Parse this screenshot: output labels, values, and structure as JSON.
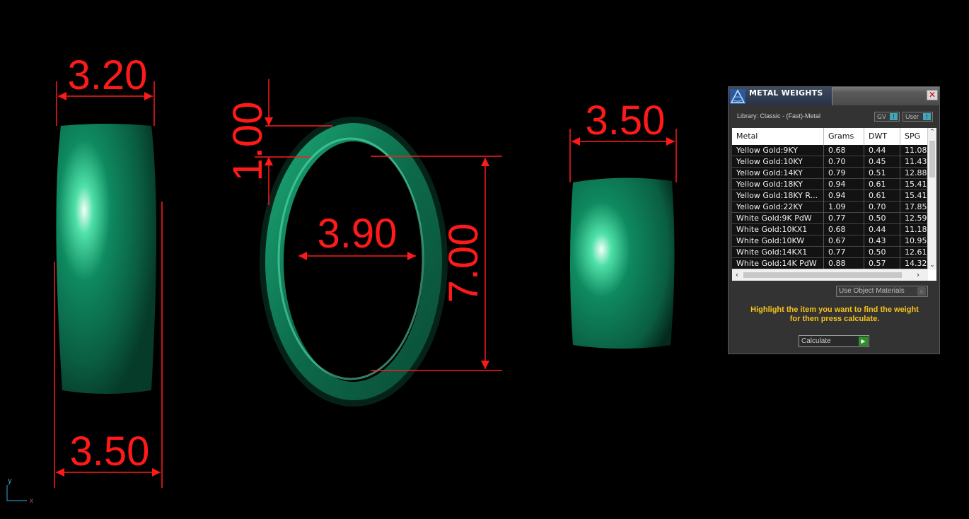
{
  "dimensions": {
    "left_top_width": "3.20",
    "left_bottom_width": "3.50",
    "middle_top_gap": "1.00",
    "middle_inner_width": "3.90",
    "middle_height": "7.00",
    "right_width": "3.50"
  },
  "axis": {
    "y_label": "y",
    "x_label": "x"
  },
  "panel": {
    "title": "METAL WEIGHTS",
    "close": "✕",
    "library": "Library: Classic - (Fast)-Metal",
    "toggle_gv": "GV",
    "toggle_user": "User",
    "toggle_knob": "!",
    "columns": [
      "Metal",
      "Grams",
      "DWT",
      "SPG"
    ],
    "rows": [
      {
        "metal": "Yellow Gold:9KY",
        "grams": "0.68",
        "dwt": "0.44",
        "spg": "11.08"
      },
      {
        "metal": "Yellow Gold:10KY",
        "grams": "0.70",
        "dwt": "0.45",
        "spg": "11.43"
      },
      {
        "metal": "Yellow Gold:14KY",
        "grams": "0.79",
        "dwt": "0.51",
        "spg": "12.88"
      },
      {
        "metal": "Yellow Gold:18KY",
        "grams": "0.94",
        "dwt": "0.61",
        "spg": "15.41"
      },
      {
        "metal": "Yellow Gold:18KY R...",
        "grams": "0.94",
        "dwt": "0.61",
        "spg": "15.41"
      },
      {
        "metal": "Yellow Gold:22KY",
        "grams": "1.09",
        "dwt": "0.70",
        "spg": "17.85"
      },
      {
        "metal": "White Gold:9K PdW",
        "grams": "0.77",
        "dwt": "0.50",
        "spg": "12.59"
      },
      {
        "metal": "White Gold:10KX1",
        "grams": "0.68",
        "dwt": "0.44",
        "spg": "11.18"
      },
      {
        "metal": "White Gold:10KW",
        "grams": "0.67",
        "dwt": "0.43",
        "spg": "10.95"
      },
      {
        "metal": "White Gold:14KX1",
        "grams": "0.77",
        "dwt": "0.50",
        "spg": "12.61"
      },
      {
        "metal": "White Gold:14K PdW",
        "grams": "0.88",
        "dwt": "0.57",
        "spg": "14.32"
      }
    ],
    "use_object_materials": "Use Object Materials",
    "hint_line1": "Highlight the item you want to find the weight",
    "hint_line2": "for then press calculate.",
    "calculate": "Calculate"
  },
  "colors": {
    "background": "#000000",
    "ring_green": "#0f7a55",
    "dimension_red": "#ff1a1a",
    "hint_yellow": "#f7c21b"
  }
}
